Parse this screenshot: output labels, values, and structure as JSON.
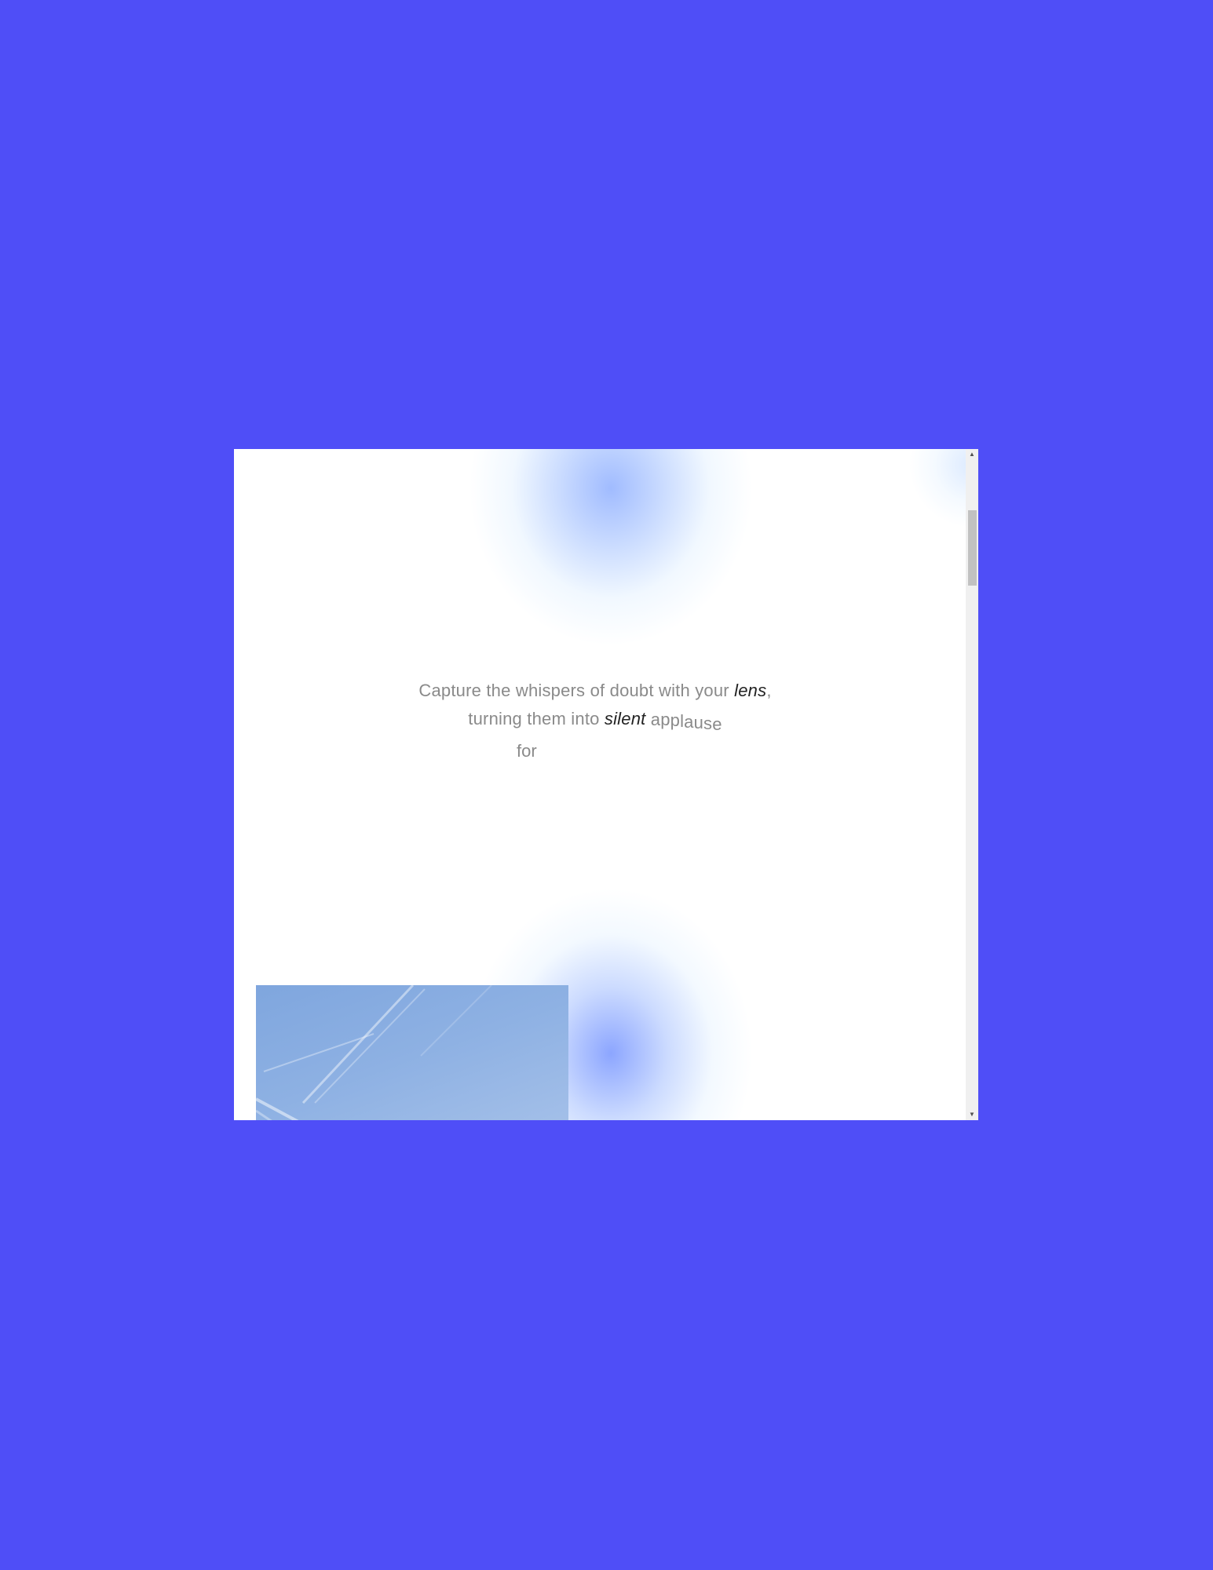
{
  "colors": {
    "background": "#4f4ef7",
    "page": "#ffffff",
    "text_muted": "#8a8a8a",
    "text_emphasis": "#222222",
    "glow": "#9fb6ff",
    "scrollbar_track": "#f0f0f0",
    "scrollbar_thumb": "#c1c1c1"
  },
  "quote": {
    "line1_start": "Capture the whispers of doubt with your ",
    "line1_em": "lens",
    "line1_end": ",",
    "line2_start": "turning them into ",
    "line2_em": "silent",
    "line2_end": "applause",
    "line3": "for"
  },
  "photo": {
    "subject": "blue sky with contrails"
  },
  "scrollbar": {
    "up_icon": "arrow-up-icon",
    "down_icon": "arrow-down-icon"
  }
}
